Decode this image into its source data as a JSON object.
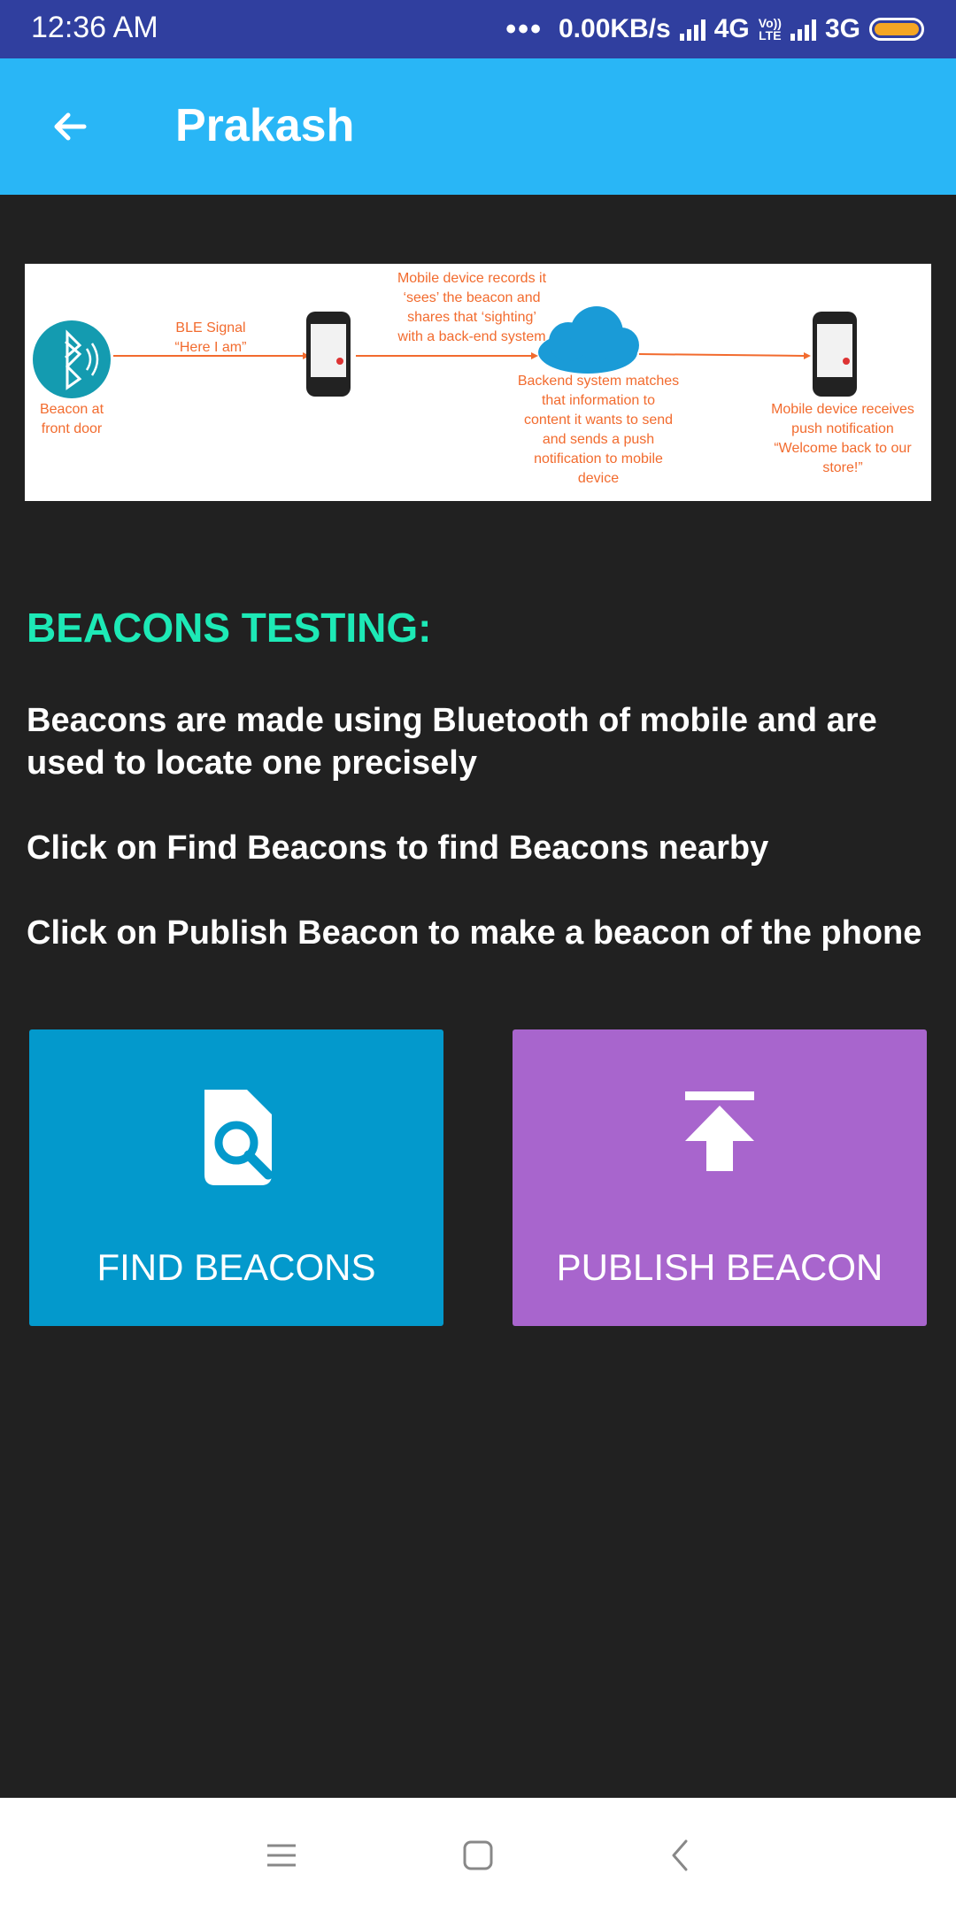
{
  "status_bar": {
    "time": "12:36 AM",
    "dots": "•••",
    "net_speed": "0.00KB/s",
    "network_1": "4G",
    "volte_top": "Vo))",
    "volte_bottom": "LTE",
    "network_2": "3G",
    "battery_color": "#F5A623"
  },
  "app_bar": {
    "title": "Prakash",
    "back_icon": "arrow-back-icon",
    "color": "#29B6F6"
  },
  "diagram": {
    "ble_signal": "BLE Signal",
    "here_i_am": "“Here I am”",
    "beacon_label_1": "Beacon at",
    "beacon_label_2": "front door",
    "records_1": "Mobile device records it",
    "records_2": "‘sees’ the beacon and",
    "records_3": "shares that ‘sighting’",
    "records_4": "with a back-end system",
    "backend_1": "Backend system matches",
    "backend_2": "that information to",
    "backend_3": "content it wants to send",
    "backend_4": "and sends a push",
    "backend_5": "notification to mobile",
    "backend_6": "device",
    "receives_1": "Mobile device receives",
    "receives_2": "push notification",
    "receives_3": "“Welcome back to our",
    "receives_4": "store!”"
  },
  "content": {
    "heading": "BEACONS TESTING:",
    "para_1": "Beacons are made using Bluetooth of mobile and are used to locate one precisely",
    "para_2": "Click on Find Beacons to find Beacons nearby",
    "para_3": "Click on Publish Beacon to make a beacon of the phone",
    "heading_color": "#1DE9B6"
  },
  "actions": {
    "find_label": "FIND BEACONS",
    "find_icon": "file-search-icon",
    "find_color": "#0399CC",
    "publish_label": "PUBLISH BEACON",
    "publish_icon": "publish-icon",
    "publish_color": "#A865CD"
  },
  "nav_bar": {
    "menu_icon": "menu-icon",
    "home_icon": "home-square-icon",
    "back_icon": "back-chevron-icon"
  }
}
